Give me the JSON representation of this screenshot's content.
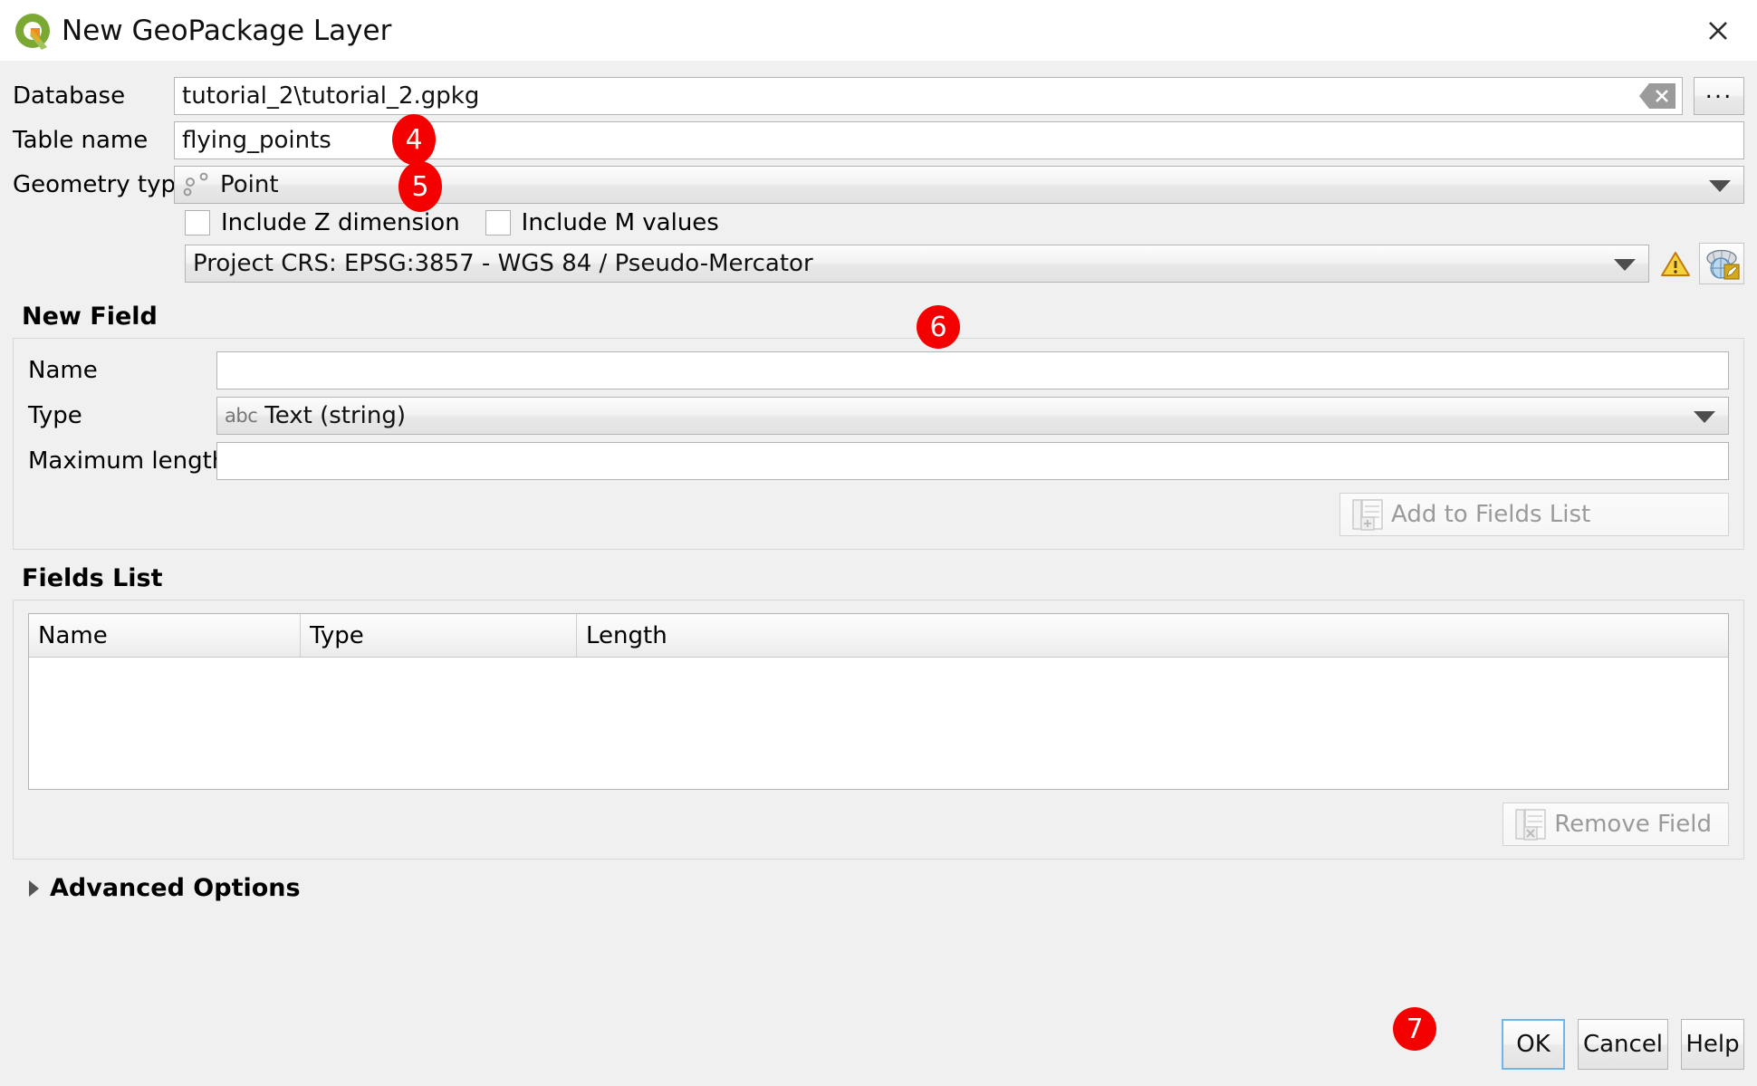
{
  "window": {
    "title": "New GeoPackage Layer",
    "logo_icon": "qgis-logo-icon",
    "close_icon": "close-icon"
  },
  "form": {
    "database": {
      "label": "Database",
      "value": "tutorial_2\\tutorial_2.gpkg",
      "placeholder": "",
      "clear_icon": "clear-icon",
      "browse_label": "..."
    },
    "table_name": {
      "label": "Table name",
      "value": "flying_points",
      "placeholder": ""
    },
    "geometry_type": {
      "label": "Geometry type",
      "value": "Point",
      "icon": "point-geometry-icon"
    },
    "include_z": {
      "label": "Include Z dimension",
      "checked": false
    },
    "include_m": {
      "label": "Include M values",
      "checked": false
    },
    "crs": {
      "value": "Project CRS: EPSG:3857 - WGS 84 / Pseudo-Mercator",
      "warning_icon": "warning-icon",
      "select_crs_icon": "select-crs-globe-icon"
    }
  },
  "new_field": {
    "title": "New Field",
    "name": {
      "label": "Name",
      "value": "",
      "placeholder": ""
    },
    "type": {
      "label": "Type",
      "value": "Text (string)",
      "icon_text": "abc"
    },
    "maximum_length": {
      "label": "Maximum length",
      "value": "",
      "placeholder": ""
    },
    "add_button": {
      "label": "Add to Fields List",
      "enabled": false,
      "icon": "add-field-icon"
    }
  },
  "fields_list": {
    "title": "Fields List",
    "columns": [
      "Name",
      "Type",
      "Length"
    ],
    "rows": [],
    "remove_button": {
      "label": "Remove Field",
      "enabled": false,
      "icon": "remove-field-icon"
    }
  },
  "advanced_options": {
    "label": "Advanced Options",
    "expanded": false,
    "icon": "chevron-right-icon"
  },
  "footer": {
    "ok_label": "OK",
    "cancel_label": "Cancel",
    "help_label": "Help"
  },
  "step_badges": [
    {
      "number": "4",
      "target": "table-name"
    },
    {
      "number": "5",
      "target": "geometry-type"
    },
    {
      "number": "6",
      "target": "crs"
    },
    {
      "number": "7",
      "target": "ok-button"
    }
  ],
  "colors": {
    "badge": "#f40000",
    "badge_text": "#ffffff",
    "dialog_background": "#f0f0f0",
    "titlebar_background": "#ffffff",
    "field_background": "#ffffff",
    "default_button_focus": "#6fb5e8"
  }
}
